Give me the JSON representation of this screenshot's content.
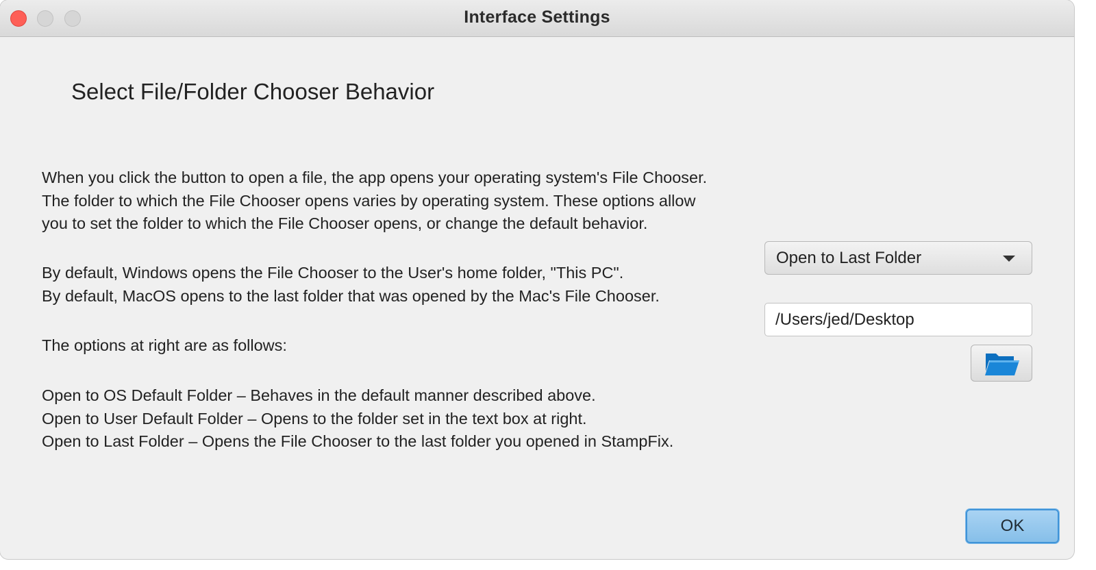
{
  "window": {
    "title": "Interface Settings"
  },
  "heading": "Select File/Folder Chooser Behavior",
  "paragraphs": {
    "intro": [
      "When you click the button to open a file, the app opens your operating system's File Chooser.",
      "The folder to which the File Chooser opens varies by operating system.  These options allow",
      "you to set the folder to which the File Chooser opens, or change the default behavior."
    ],
    "defaults": [
      "By default, Windows opens the File Chooser to the User's home folder, \"This PC\".",
      "By default, MacOS opens to the last folder that was opened by the Mac's File Chooser."
    ],
    "options_intro": "The options at right are as follows:",
    "options": [
      "Open to OS Default Folder – Behaves in the default manner described above.",
      "Open to User Default Folder – Opens to the folder set in the text box at right.",
      "Open to Last Folder – Opens the File Chooser to the last folder you opened in StampFix."
    ]
  },
  "chooser_mode": {
    "selected": "Open to Last Folder",
    "icon": "chevron-down-icon"
  },
  "default_folder": {
    "value": "/Users/jed/Desktop"
  },
  "browse_button": {
    "icon": "folder-open-icon",
    "icon_color": "#1a86d8"
  },
  "ok_button": {
    "label": "OK",
    "accent": "#86bfe9"
  }
}
